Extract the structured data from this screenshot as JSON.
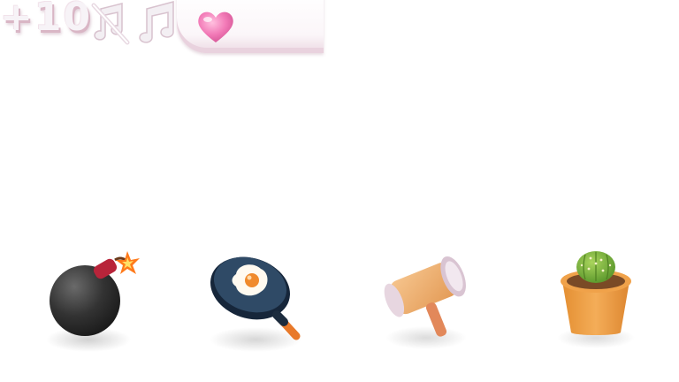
{
  "hud": {
    "score_text": "+10"
  },
  "icons": {
    "music_muted": "music-muted-icon",
    "music_on": "music-note-icon",
    "life": "heart-icon"
  },
  "items": [
    "bomb",
    "frying-pan-egg",
    "mallet",
    "potted-cactus"
  ],
  "colors": {
    "heart": "#f27ab7",
    "panel": "#fbf6f9",
    "bomb": "#3a3a3a",
    "pan": "#203448",
    "hammer_head": "#f0b071",
    "pot": "#f0a24a",
    "cactus": "#7fb540"
  }
}
